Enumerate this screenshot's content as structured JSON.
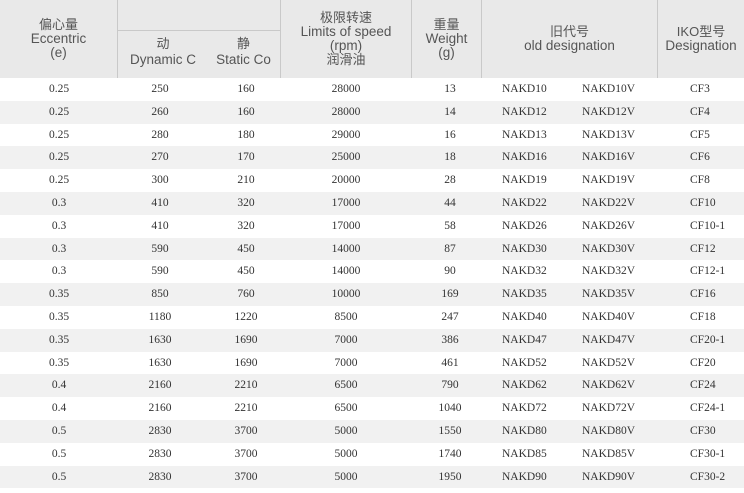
{
  "header": {
    "eccentric": {
      "zh": "偏心量",
      "en": "Eccentric",
      "unit": "(e)"
    },
    "dynamic": {
      "zh": "动",
      "en": "Dynamic C"
    },
    "static": {
      "zh": "静",
      "en": "Static Co"
    },
    "speed": {
      "zh": "极限转速",
      "en": "Limits of speed",
      "unit": "(rpm)",
      "sub": "润滑油"
    },
    "weight": {
      "zh": "重量",
      "en": "Weight",
      "unit": "(g)"
    },
    "old": {
      "zh": "旧代号",
      "en": "old designation"
    },
    "iko": {
      "zh": "IKO型号",
      "en": "Designation"
    }
  },
  "rows": [
    {
      "ecc": "0.25",
      "dyn": "250",
      "sta": "160",
      "spd": "28000",
      "wt": "13",
      "old1": "NAKD10",
      "old2": "NAKD10V",
      "iko": "CF3"
    },
    {
      "ecc": "0.25",
      "dyn": "260",
      "sta": "160",
      "spd": "28000",
      "wt": "14",
      "old1": "NAKD12",
      "old2": "NAKD12V",
      "iko": "CF4"
    },
    {
      "ecc": "0.25",
      "dyn": "280",
      "sta": "180",
      "spd": "29000",
      "wt": "16",
      "old1": "NAKD13",
      "old2": "NAKD13V",
      "iko": "CF5"
    },
    {
      "ecc": "0.25",
      "dyn": "270",
      "sta": "170",
      "spd": "25000",
      "wt": "18",
      "old1": "NAKD16",
      "old2": "NAKD16V",
      "iko": "CF6"
    },
    {
      "ecc": "0.25",
      "dyn": "300",
      "sta": "210",
      "spd": "20000",
      "wt": "28",
      "old1": "NAKD19",
      "old2": "NAKD19V",
      "iko": "CF8"
    },
    {
      "ecc": "0.3",
      "dyn": "410",
      "sta": "320",
      "spd": "17000",
      "wt": "44",
      "old1": "NAKD22",
      "old2": "NAKD22V",
      "iko": "CF10"
    },
    {
      "ecc": "0.3",
      "dyn": "410",
      "sta": "320",
      "spd": "17000",
      "wt": "58",
      "old1": "NAKD26",
      "old2": "NAKD26V",
      "iko": "CF10-1"
    },
    {
      "ecc": "0.3",
      "dyn": "590",
      "sta": "450",
      "spd": "14000",
      "wt": "87",
      "old1": "NAKD30",
      "old2": "NAKD30V",
      "iko": "CF12"
    },
    {
      "ecc": "0.3",
      "dyn": "590",
      "sta": "450",
      "spd": "14000",
      "wt": "90",
      "old1": "NAKD32",
      "old2": "NAKD32V",
      "iko": "CF12-1"
    },
    {
      "ecc": "0.35",
      "dyn": "850",
      "sta": "760",
      "spd": "10000",
      "wt": "169",
      "old1": "NAKD35",
      "old2": "NAKD35V",
      "iko": "CF16"
    },
    {
      "ecc": "0.35",
      "dyn": "1180",
      "sta": "1220",
      "spd": "8500",
      "wt": "247",
      "old1": "NAKD40",
      "old2": "NAKD40V",
      "iko": "CF18"
    },
    {
      "ecc": "0.35",
      "dyn": "1630",
      "sta": "1690",
      "spd": "7000",
      "wt": "386",
      "old1": "NAKD47",
      "old2": "NAKD47V",
      "iko": "CF20-1"
    },
    {
      "ecc": "0.35",
      "dyn": "1630",
      "sta": "1690",
      "spd": "7000",
      "wt": "461",
      "old1": "NAKD52",
      "old2": "NAKD52V",
      "iko": "CF20"
    },
    {
      "ecc": "0.4",
      "dyn": "2160",
      "sta": "2210",
      "spd": "6500",
      "wt": "790",
      "old1": "NAKD62",
      "old2": "NAKD62V",
      "iko": "CF24"
    },
    {
      "ecc": "0.4",
      "dyn": "2160",
      "sta": "2210",
      "spd": "6500",
      "wt": "1040",
      "old1": "NAKD72",
      "old2": "NAKD72V",
      "iko": "CF24-1"
    },
    {
      "ecc": "0.5",
      "dyn": "2830",
      "sta": "3700",
      "spd": "5000",
      "wt": "1550",
      "old1": "NAKD80",
      "old2": "NAKD80V",
      "iko": "CF30"
    },
    {
      "ecc": "0.5",
      "dyn": "2830",
      "sta": "3700",
      "spd": "5000",
      "wt": "1740",
      "old1": "NAKD85",
      "old2": "NAKD85V",
      "iko": "CF30-1"
    },
    {
      "ecc": "0.5",
      "dyn": "2830",
      "sta": "3700",
      "spd": "5000",
      "wt": "1950",
      "old1": "NAKD90",
      "old2": "NAKD90V",
      "iko": "CF30-2"
    }
  ]
}
